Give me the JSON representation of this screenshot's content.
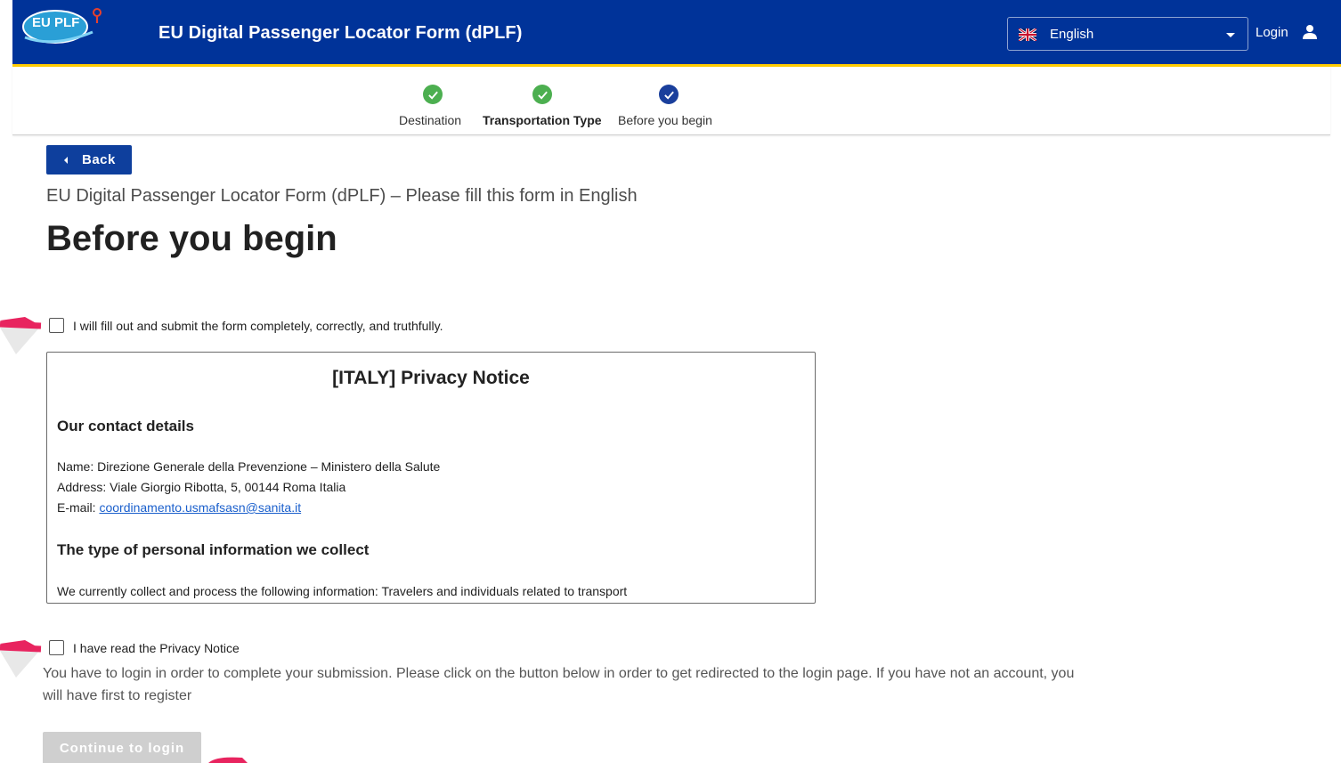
{
  "header": {
    "logo_text": "EU PLF",
    "title": "EU Digital Passenger Locator Form (dPLF)",
    "language": "English",
    "login_label": "Login"
  },
  "stepper": {
    "steps": [
      {
        "label": "Destination",
        "state": "done"
      },
      {
        "label": "Transportation Type",
        "state": "done"
      },
      {
        "label": "Before you begin",
        "state": "active"
      }
    ]
  },
  "main": {
    "back_label": "Back",
    "subtitle": "EU Digital Passenger Locator Form (dPLF) – Please fill this form in English",
    "title": "Before you begin",
    "checkbox_truthful": "I will fill out and submit the form completely, correctly, and truthfully.",
    "notice": {
      "title": "[ITALY] Privacy Notice",
      "contact_heading": "Our contact details",
      "name_line": "Name: Direzione Generale della Prevenzione – Ministero della Salute",
      "address_line": "Address: Viale Giorgio Ribotta, 5, 00144 Roma Italia",
      "email_prefix": "E-mail: ",
      "email": "coordinamento.usmafsasn@sanita.it",
      "info_heading": "The type of personal information we collect",
      "info_text": "We currently collect and process the following information: Travelers and individuals related to transport"
    },
    "checkbox_privacy": "I have read the Privacy Notice",
    "login_info": "You have to login in order to complete your submission. Please click on the button below in order to get redirected to the login page. If you have not an account, you will have first to register",
    "continue_label": "Continue to login"
  },
  "colors": {
    "header_bg": "#003399",
    "accent": "#ffcc00",
    "step_done": "#4caf50",
    "step_active": "#1a3f9c",
    "button_primary": "#0e3f9d",
    "button_disabled": "#cfcfcf",
    "annotation": "#e8245f"
  }
}
